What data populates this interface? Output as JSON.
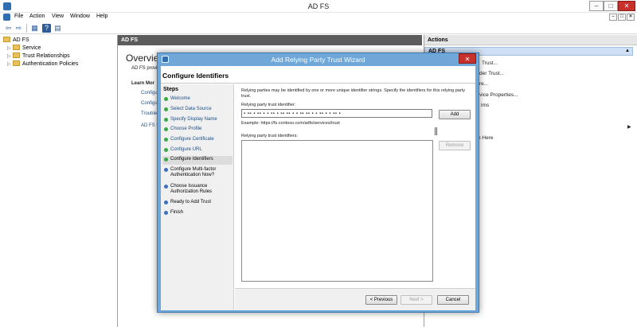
{
  "window": {
    "title": "AD FS",
    "min_glyph": "‒",
    "max_glyph": "□",
    "close_glyph": "✕"
  },
  "menu": {
    "items": [
      "File",
      "Action",
      "View",
      "Window",
      "Help"
    ]
  },
  "mdi_buttons": {
    "min": "–",
    "max": "□",
    "close": "✕"
  },
  "toolbar": {
    "back": "⇦",
    "forward": "⇨",
    "show_tree": "▦",
    "help": "?",
    "properties": "▤"
  },
  "tree": {
    "root": "AD FS",
    "items": [
      "Service",
      "Trust Relationships",
      "Authentication Policies"
    ]
  },
  "center": {
    "header": "AD FS",
    "overview_title": "Overview",
    "prov_text": "AD FS provi",
    "learn_more": "Learn Mor",
    "links": [
      "Configure",
      "Configur",
      "Troublesh",
      "AD FS Hel"
    ]
  },
  "actions": {
    "header": "Actions",
    "subheader": "AD FS",
    "collapse_glyph": "▲",
    "items": [
      "Trust...",
      "der Trust...",
      "re...",
      "rvice Properties...",
      "ims",
      "n Here"
    ],
    "submenu_arrow": "▶"
  },
  "dialog": {
    "title": "Add Relying Party Trust Wizard",
    "close_glyph": "✕",
    "header": "Configure Identifiers",
    "steps_title": "Steps",
    "steps": [
      {
        "label": "Welcome",
        "state": "done"
      },
      {
        "label": "Select Data Source",
        "state": "done"
      },
      {
        "label": "Specify Display Name",
        "state": "done"
      },
      {
        "label": "Choose Profile",
        "state": "done"
      },
      {
        "label": "Configure Certificate",
        "state": "done"
      },
      {
        "label": "Configure URL",
        "state": "done"
      },
      {
        "label": "Configure Identifiers",
        "state": "current"
      },
      {
        "label": "Configure Multi-factor Authentication Now?",
        "state": "todo"
      },
      {
        "label": "Choose Issuance Authorization Rules",
        "state": "todo"
      },
      {
        "label": "Ready to Add Trust",
        "state": "todo"
      },
      {
        "label": "Finish",
        "state": "todo"
      }
    ],
    "description": "Relying parties may be identified by one or more unique identifier strings. Specify the identifiers for this relying party trust.",
    "identifier_label": "Relying party trust identifier:",
    "identifier_value": "▪ ▪▪ ▪ ▪▪ ▪ ▪ ▪▪ ▪ ▪▪ ▪▪ ▪ ▪ ▪▪ ▪▪ ▪ ▪ ▪▪ ▪ ▪ ▪▪ ▪",
    "add_label": "Add",
    "example": "Example: https://fs.contoso.com/adfs/services/trust",
    "identifiers_label": "Relying party trust identifiers:",
    "remove_label": "Remove",
    "previous_label": "< Previous",
    "next_label": "Next >",
    "cancel_label": "Cancel"
  },
  "colors": {
    "dialog_frame": "#6ea7d8",
    "close_red": "#c7302b",
    "step_done": "#39a845",
    "step_todo": "#3d6fbf",
    "link": "#1b4e85"
  }
}
